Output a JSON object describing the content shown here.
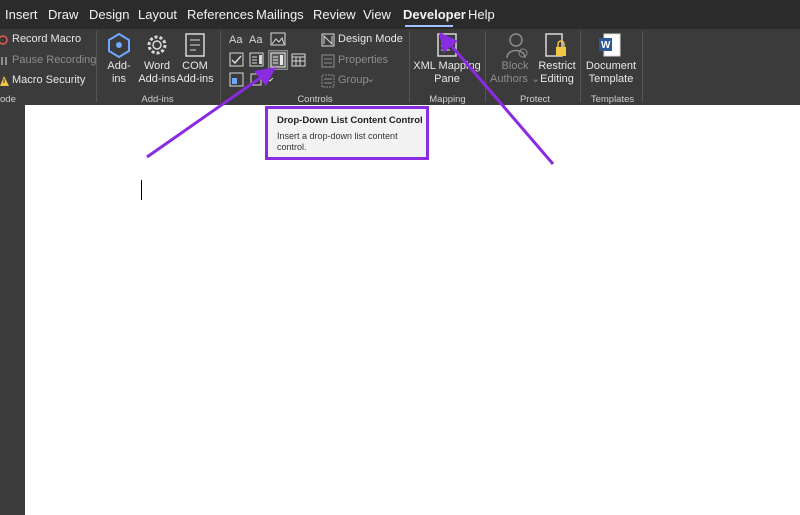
{
  "tabs": [
    "Insert",
    "Draw",
    "Design",
    "Layout",
    "References",
    "Mailings",
    "Review",
    "View",
    "Developer",
    "Help"
  ],
  "active_tab": "Developer",
  "ribbon": {
    "code": {
      "record_macro": "Record Macro",
      "pause_recording": "Pause Recording",
      "macro_security": "Macro Security",
      "group_label": "ode"
    },
    "addins": {
      "add_ins": [
        "Add-",
        "ins"
      ],
      "word_add_ins": [
        "Word",
        "Add-ins"
      ],
      "com_add_ins": [
        "COM",
        "Add-ins"
      ],
      "group_label": "Add-ins"
    },
    "controls": {
      "design_mode": "Design Mode",
      "properties": "Properties",
      "group": "Group",
      "group_label": "Controls"
    },
    "mapping": {
      "xml_mapping_pane": [
        "XML Mapping",
        "Pane"
      ],
      "group_label": "Mapping"
    },
    "protect": {
      "block_authors": [
        "Block",
        "Authors"
      ],
      "restrict_editing": [
        "Restrict",
        "Editing"
      ],
      "group_label": "Protect"
    },
    "templates": {
      "document_template": [
        "Document",
        "Template"
      ],
      "group_label": "Templates"
    }
  },
  "tooltip": {
    "title": "Drop-Down List Content Control",
    "body": "Insert a drop-down list content control."
  },
  "colors": {
    "ribbon_bg": "#3b3b3b",
    "tabbar_bg": "#2b2b2b",
    "annotation": "#8a2be2",
    "active_underline": "#9ec3ff"
  }
}
